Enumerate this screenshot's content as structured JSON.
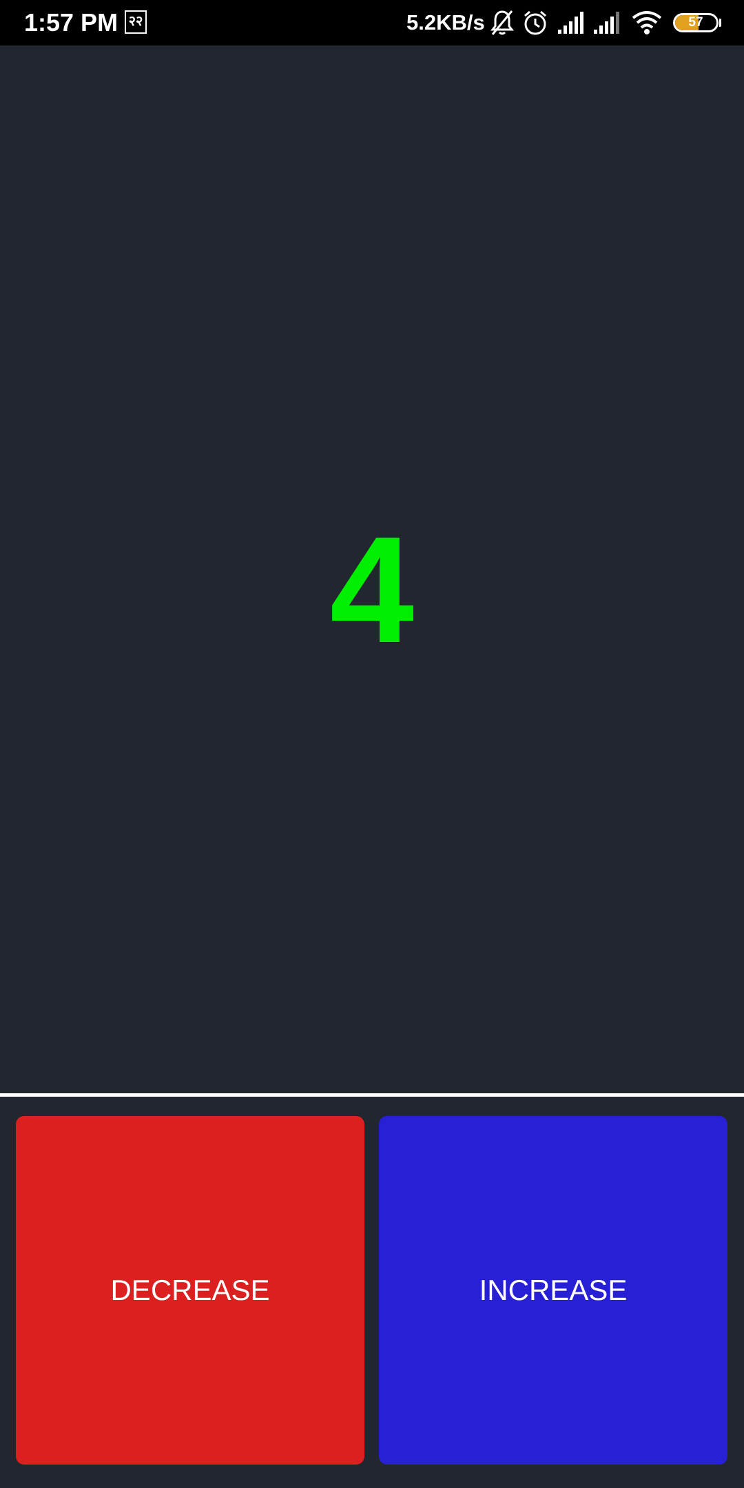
{
  "status_bar": {
    "time": "1:57 PM",
    "notification_glyph": "२२",
    "network_speed": "5.2KB/s",
    "icons": [
      "bell-off-icon",
      "alarm-icon",
      "signal-icon",
      "signal-icon",
      "wifi-icon"
    ],
    "battery_level": "57",
    "battery_fraction": 0.57,
    "battery_color": "#e0a020"
  },
  "counter": {
    "value": "4",
    "color": "#00ee00"
  },
  "buttons": {
    "decrease_label": "DECREASE",
    "decrease_color": "#dc1f1f",
    "increase_label": "INCREASE",
    "increase_color": "#2720d4"
  }
}
